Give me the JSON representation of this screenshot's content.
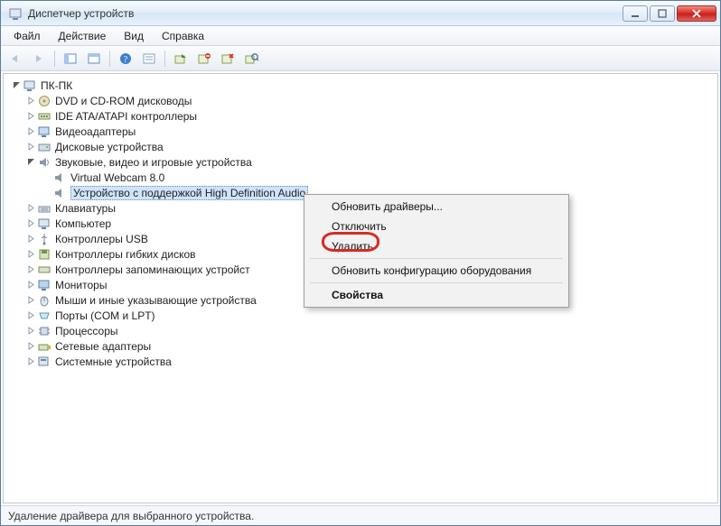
{
  "window": {
    "title": "Диспетчер устройств"
  },
  "menu": {
    "file": "Файл",
    "action": "Действие",
    "view": "Вид",
    "help": "Справка"
  },
  "tree": {
    "root": "ПК-ПК",
    "dvd": "DVD и CD-ROM дисководы",
    "ide": "IDE ATA/ATAPI контроллеры",
    "video": "Видеоадаптеры",
    "disks": "Дисковые устройства",
    "audio": "Звуковые, видео и игровые устройства",
    "audio_children": {
      "vwc": "Virtual Webcam 8.0",
      "hd": "Устройство с поддержкой High Definition Audio"
    },
    "keyboards": "Клавиатуры",
    "computer": "Компьютер",
    "usb": "Контроллеры USB",
    "floppy": "Контроллеры гибких дисков",
    "storage": "Контроллеры запоминающих устройст",
    "monitors": "Мониторы",
    "mice": "Мыши и иные указывающие устройства",
    "ports": "Порты (COM и LPT)",
    "cpu": "Процессоры",
    "netadapters": "Сетевые адаптеры",
    "sysdev": "Системные устройства"
  },
  "context_menu": {
    "update": "Обновить драйверы...",
    "disable": "Отключить",
    "delete": "Удалить",
    "rescan": "Обновить конфигурацию оборудования",
    "properties": "Свойства"
  },
  "statusbar": {
    "text": "Удаление драйвера для выбранного устройства."
  }
}
